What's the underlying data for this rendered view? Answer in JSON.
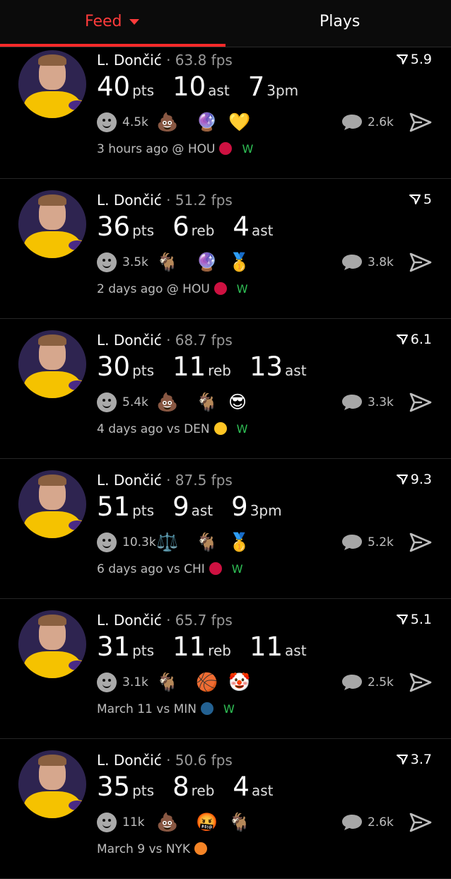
{
  "tabs": {
    "feed": "Feed",
    "plays": "Plays"
  },
  "cards": [
    {
      "name": "L. Dončić",
      "fps": "63.8 fps",
      "score": "5.9",
      "stats": [
        {
          "n": "40",
          "l": "pts"
        },
        {
          "n": "10",
          "l": "ast"
        },
        {
          "n": "7",
          "l": "3pm"
        }
      ],
      "reactions": "4.5k",
      "emojis": [
        "💩",
        "🔮",
        "💛"
      ],
      "comments": "2.6k",
      "when": "3 hours ago @ HOU",
      "team_logo": "rockets-logo",
      "team_color": "#ce1141",
      "result": "W"
    },
    {
      "name": "L. Dončić",
      "fps": "51.2 fps",
      "score": "5",
      "stats": [
        {
          "n": "36",
          "l": "pts"
        },
        {
          "n": "6",
          "l": "reb"
        },
        {
          "n": "4",
          "l": "ast"
        }
      ],
      "reactions": "3.5k",
      "emojis": [
        "🐐",
        "🔮",
        "🥇"
      ],
      "comments": "3.8k",
      "when": "2 days ago @ HOU",
      "team_logo": "rockets-logo",
      "team_color": "#ce1141",
      "result": "W"
    },
    {
      "name": "L. Dončić",
      "fps": "68.7 fps",
      "score": "6.1",
      "stats": [
        {
          "n": "30",
          "l": "pts"
        },
        {
          "n": "11",
          "l": "reb"
        },
        {
          "n": "13",
          "l": "ast"
        }
      ],
      "reactions": "5.4k",
      "emojis": [
        "💩",
        "🐐",
        "😎"
      ],
      "comments": "3.3k",
      "when": "4 days ago vs DEN",
      "team_logo": "nuggets-logo",
      "team_color": "#fec524",
      "result": "W"
    },
    {
      "name": "L. Dončić",
      "fps": "87.5 fps",
      "score": "9.3",
      "stats": [
        {
          "n": "51",
          "l": "pts"
        },
        {
          "n": "9",
          "l": "ast"
        },
        {
          "n": "9",
          "l": "3pm"
        }
      ],
      "reactions": "10.3k",
      "emojis": [
        "⚖️",
        "🐐",
        "🥇"
      ],
      "comments": "5.2k",
      "when": "6 days ago vs CHI",
      "team_logo": "bulls-logo",
      "team_color": "#ce1141",
      "result": "W"
    },
    {
      "name": "L. Dončić",
      "fps": "65.7 fps",
      "score": "5.1",
      "stats": [
        {
          "n": "31",
          "l": "pts"
        },
        {
          "n": "11",
          "l": "reb"
        },
        {
          "n": "11",
          "l": "ast"
        }
      ],
      "reactions": "3.1k",
      "emojis": [
        "🐐",
        "🏀",
        "🤡"
      ],
      "comments": "2.5k",
      "when": "March 11 vs MIN",
      "team_logo": "timberwolves-logo",
      "team_color": "#236192",
      "result": "W"
    },
    {
      "name": "L. Dončić",
      "fps": "50.6 fps",
      "score": "3.7",
      "stats": [
        {
          "n": "35",
          "l": "pts"
        },
        {
          "n": "8",
          "l": "reb"
        },
        {
          "n": "4",
          "l": "ast"
        }
      ],
      "reactions": "11k",
      "emojis": [
        "💩",
        "🤬",
        "🐐"
      ],
      "comments": "2.6k",
      "when": "March 9 vs NYK",
      "team_logo": "knicks-logo",
      "team_color": "#f58426",
      "result": ""
    }
  ],
  "colors": {
    "accent": "#ff2a2a",
    "win": "#2fbf55",
    "muted": "#9a9a9a"
  },
  "icons": {
    "score": "fire-chevron-icon",
    "comment": "speech-bubble-icon",
    "share": "send-icon",
    "react": "smiley-icon"
  }
}
